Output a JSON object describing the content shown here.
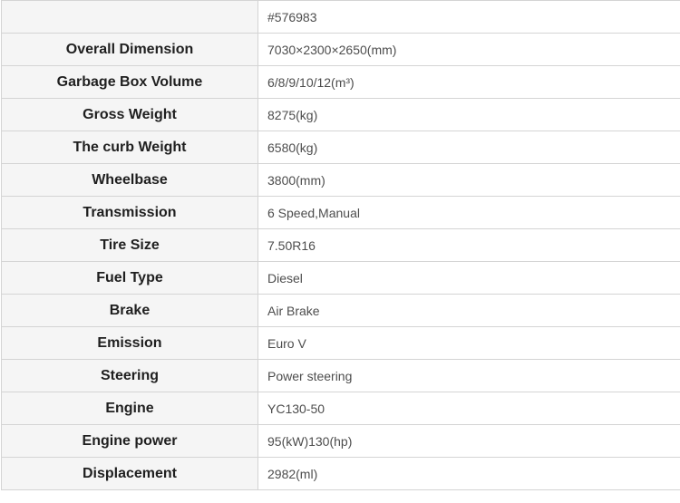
{
  "table": {
    "header": {
      "label": "",
      "value": "#576983"
    },
    "rows": [
      {
        "label": "Overall Dimension",
        "value": "7030×2300×2650(mm)"
      },
      {
        "label": "Garbage Box Volume",
        "value": "6/8/9/10/12(m³)"
      },
      {
        "label": "Gross Weight",
        "value": "8275(kg)"
      },
      {
        "label": "The curb Weight",
        "value": "6580(kg)"
      },
      {
        "label": "Wheelbase",
        "value": "3800(mm)"
      },
      {
        "label": "Transmission",
        "value": "6 Speed,Manual"
      },
      {
        "label": "Tire Size",
        "value": "7.50R16"
      },
      {
        "label": "Fuel Type",
        "value": "Diesel"
      },
      {
        "label": "Brake",
        "value": "Air Brake"
      },
      {
        "label": "Emission",
        "value": "Euro V"
      },
      {
        "label": "Steering",
        "value": "Power steering"
      },
      {
        "label": "Engine",
        "value": "YC130-50"
      },
      {
        "label": "Engine power",
        "value": "95(kW)130(hp)"
      },
      {
        "label": "Displacement",
        "value": "2982(ml)"
      }
    ]
  }
}
